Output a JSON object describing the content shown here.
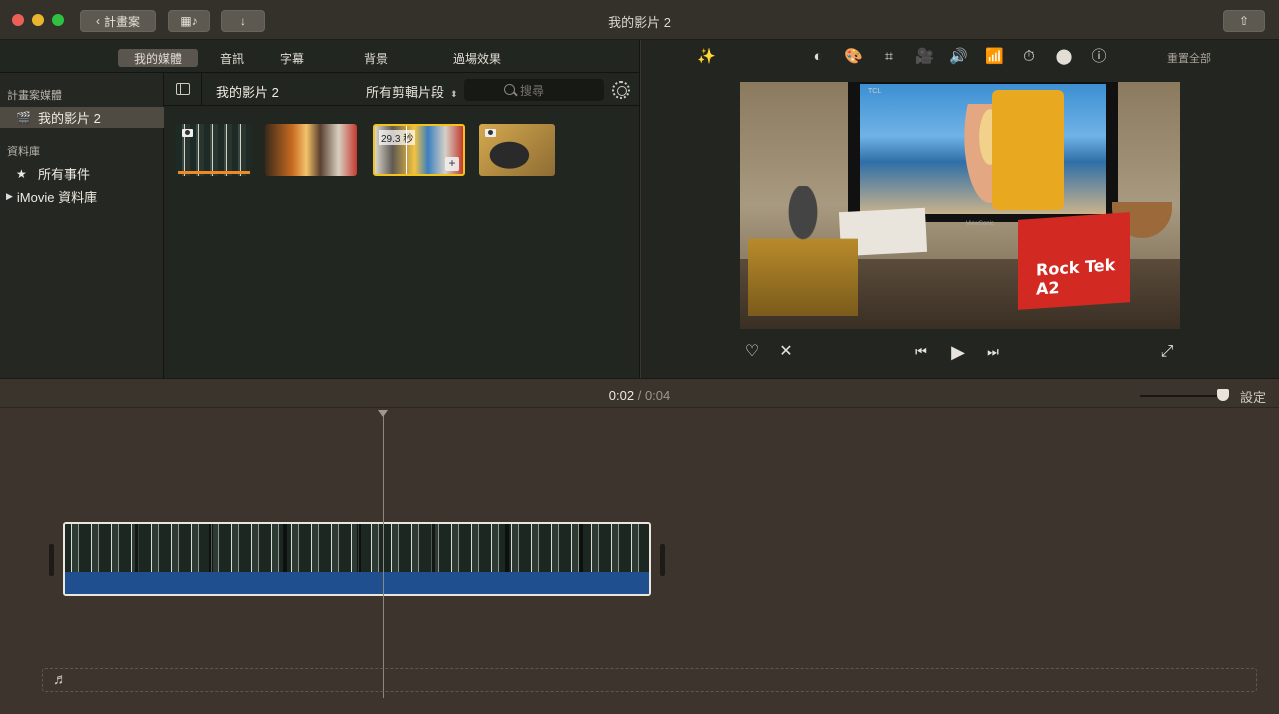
{
  "window": {
    "title": "我的影片 2",
    "back_label": "計畫案"
  },
  "browser_tabs": [
    "我的媒體",
    "音訊",
    "字幕",
    "背景",
    "過場效果"
  ],
  "sidebar": {
    "section_project": "計畫案媒體",
    "project_item": "我的影片 2",
    "section_library": "資料庫",
    "all_events": "所有事件",
    "library": "iMovie 資料庫"
  },
  "content_toolbar": {
    "project_name": "我的影片 2",
    "filter": "所有剪輯片段",
    "search_placeholder": "搜尋"
  },
  "clips": [
    {
      "name": "clip-keyboard-photo"
    },
    {
      "name": "clip-desk-fire"
    },
    {
      "name": "clip-selected",
      "duration": "29.3 秒"
    },
    {
      "name": "clip-keyboard-photo-2"
    }
  ],
  "viewer": {
    "reset_all": "重置全部",
    "video_labels": {
      "tcl": "TCL",
      "viewsonic": "ViewSonic",
      "box": "Rock Tek A2"
    }
  },
  "timeline": {
    "current_time": "0:02",
    "separator": "/",
    "duration": "0:04",
    "settings_label": "設定"
  },
  "icons": {
    "magic_wand": "✨",
    "color_balance": "◐",
    "color_palette": "🎨",
    "crop": "⌗",
    "stabilize": "🎥",
    "volume": "🔊",
    "equalizer": "📶",
    "speed": "⏱",
    "filters": "⬤",
    "info": "ⓘ",
    "favorite": "♡",
    "reject": "✕",
    "skip_back": "⏮",
    "play": "▶",
    "skip_forward": "⏭",
    "fullscreen": "⤢",
    "music": "♬"
  },
  "colors": {
    "selection_yellow": "#f2c31b",
    "audio_blue": "#1f4f8f",
    "range_orange": "#f08a20"
  }
}
